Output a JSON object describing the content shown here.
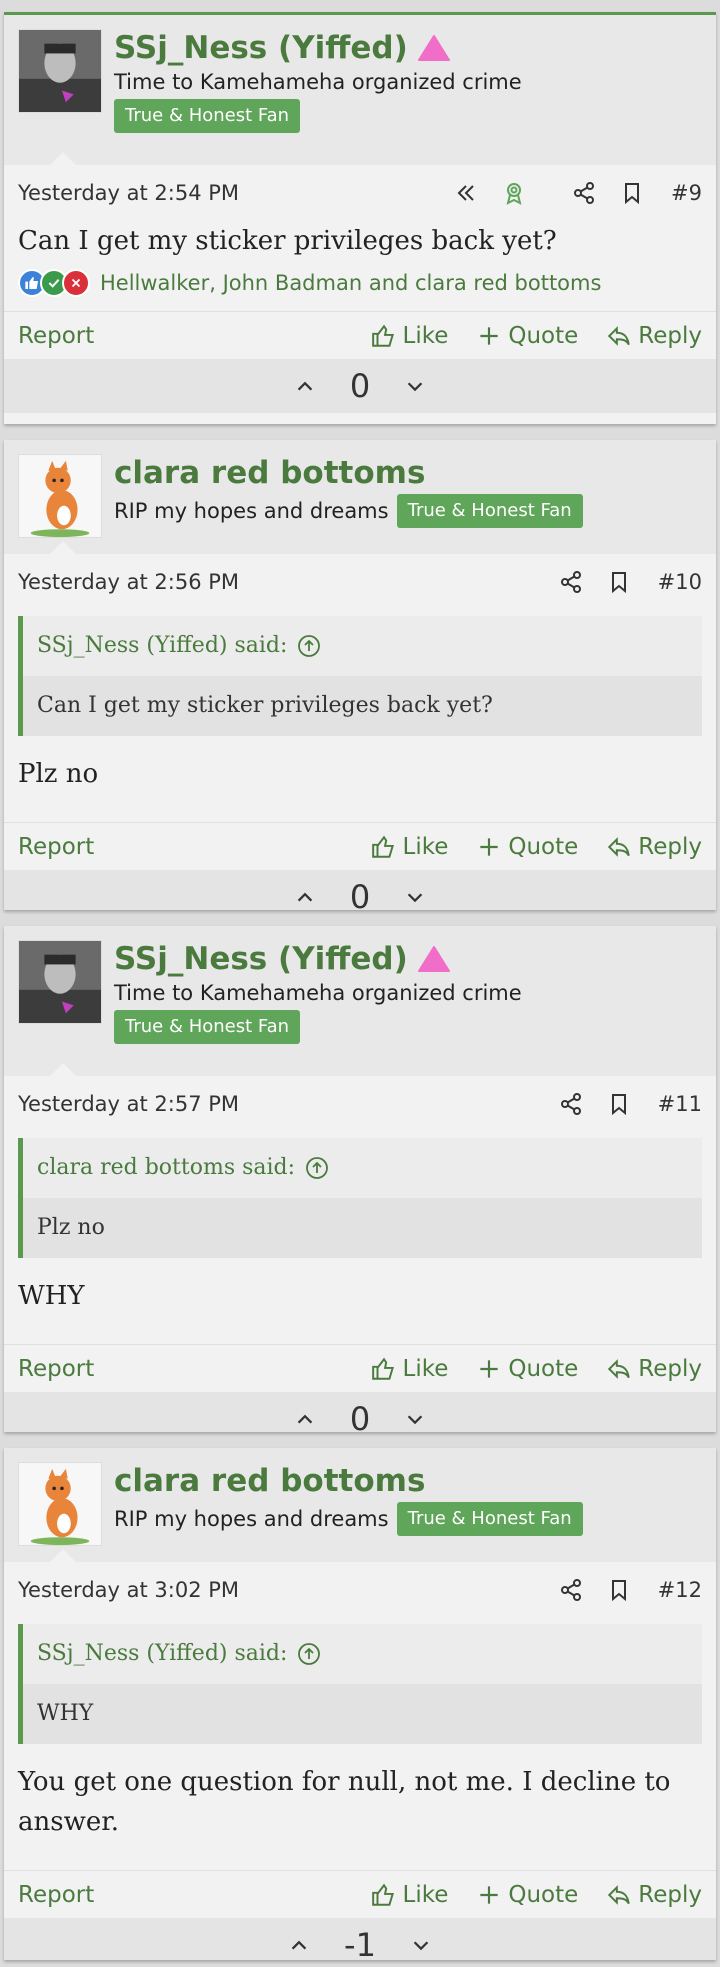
{
  "posts": [
    {
      "username": "SSj_Ness (Yiffed)",
      "user_title": "Time to Kamehameha organized crime",
      "banner": "True & Honest Fan",
      "date": "Yesterday at 2:54 PM",
      "number": "#9",
      "quote": null,
      "body": "Can I get my sticker privileges back yet?",
      "reactions": "Hellwalker, John Badman and clara red bottoms",
      "report": "Report",
      "like": "Like",
      "quote_label": "Quote",
      "reply": "Reply",
      "score": "0"
    },
    {
      "username": "clara red bottoms",
      "user_title": "RIP my hopes and dreams",
      "banner": "True & Honest Fan",
      "date": "Yesterday at 2:56 PM",
      "number": "#10",
      "quote": {
        "author": "SSj_Ness (Yiffed) said:",
        "text": "Can I get my sticker privileges back yet?"
      },
      "body": "Plz no",
      "report": "Report",
      "like": "Like",
      "quote_label": "Quote",
      "reply": "Reply",
      "score": "0"
    },
    {
      "username": "SSj_Ness (Yiffed)",
      "user_title": "Time to Kamehameha organized crime",
      "banner": "True & Honest Fan",
      "date": "Yesterday at 2:57 PM",
      "number": "#11",
      "quote": {
        "author": "clara red bottoms said:",
        "text": "Plz no"
      },
      "body": "WHY",
      "report": "Report",
      "like": "Like",
      "quote_label": "Quote",
      "reply": "Reply",
      "score": "0"
    },
    {
      "username": "clara red bottoms",
      "user_title": "RIP my hopes and dreams",
      "banner": "True & Honest Fan",
      "date": "Yesterday at 3:02 PM",
      "number": "#12",
      "quote": {
        "author": "SSj_Ness (Yiffed) said:",
        "text": "WHY"
      },
      "body": "You get one question for null, not me. I decline to answer.",
      "report": "Report",
      "like": "Like",
      "quote_label": "Quote",
      "reply": "Reply",
      "score": "-1"
    }
  ],
  "colors": {
    "accent": "#4a7a3d",
    "banner": "#5fa55a",
    "role_icon": "#f06ec8"
  }
}
